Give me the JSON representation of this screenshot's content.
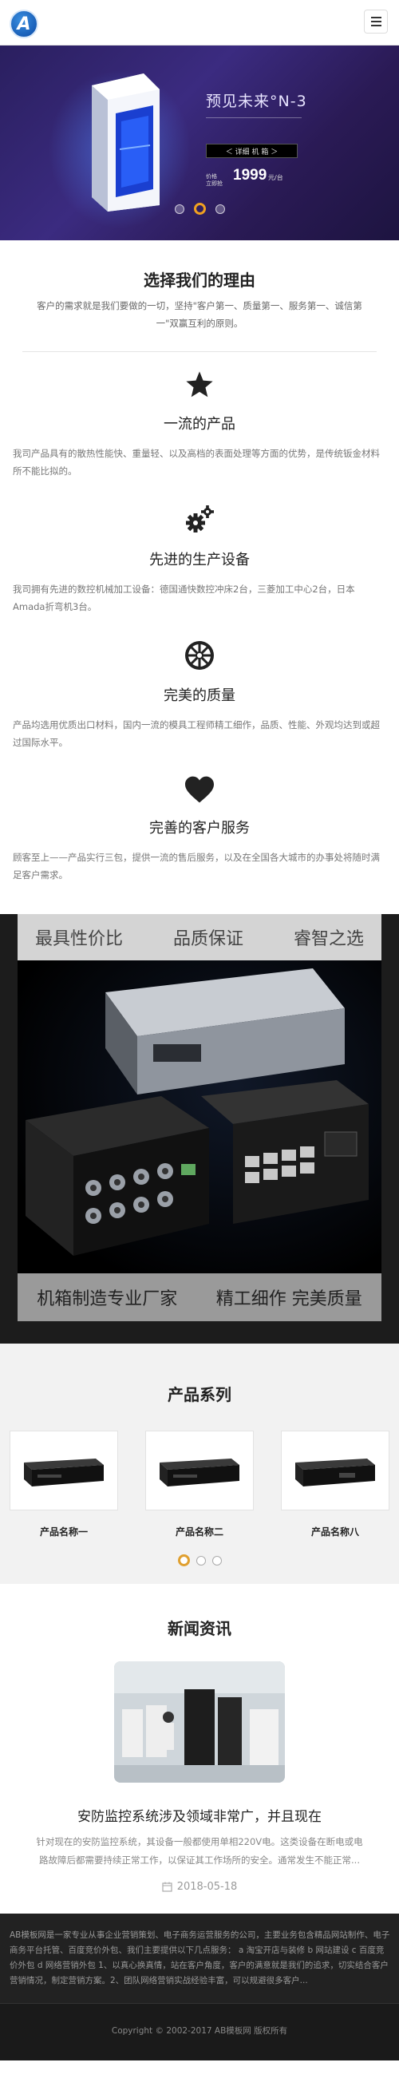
{
  "header": {
    "logo_letter": "A"
  },
  "banner": {
    "title": "预见未来°N-3",
    "button": "＜ 详细 机 箱 ＞",
    "price_label_line1": "价格",
    "price_label_line2": "立即抢",
    "price": "1999",
    "price_unit": "元/台"
  },
  "reasons": {
    "title": "选择我们的理由",
    "subtitle": "客户的需求就是我们要做的一切，坚持\"客户第一、质量第一、服务第一、诚信第一\"双赢互利的原则。",
    "features": [
      {
        "title": "一流的产品",
        "text": "我司产品具有的散热性能快、重量轻、以及高档的表面处理等方面的优势，是传统钣金材料所不能比拟的。"
      },
      {
        "title": "先进的生产设备",
        "text": "我司拥有先进的数控机械加工设备：德国通快数控冲床2台，三菱加工中心2台，日本Amada折弯机3台。"
      },
      {
        "title": "完美的质量",
        "text": "产品均选用优质出口材料，国内一流的模具工程师精工细作，品质、性能、外观均达到或超过国际水平。"
      },
      {
        "title": "完善的客户服务",
        "text": "顾客至上——产品实行三包，提供一流的售后服务，以及在全国各大城市的办事处将随时满足客户需求。"
      }
    ]
  },
  "promo": {
    "top": [
      "最具性价比",
      "品质保证",
      "睿智之选"
    ],
    "bottom": [
      "机箱制造专业厂家",
      "精工细作 完美质量"
    ]
  },
  "products": {
    "title": "产品系列",
    "items": [
      {
        "name": "产品名称一"
      },
      {
        "name": "产品名称二"
      },
      {
        "name": "产品名称八"
      }
    ]
  },
  "news": {
    "title": "新闻资讯",
    "headline": "安防监控系统涉及领域非常广，并且现在",
    "summary": "针对现在的安防监控系统，其设备一般都使用单相220V电。这类设备在断电或电路故障后都需要持续正常工作，以保证其工作场所的安全。通常发生不能正常...",
    "date": "2018-05-18"
  },
  "footer": {
    "text": "AB模板网是一家专业从事企业营销策划、电子商务运营服务的公司，主要业务包含精品网站制作、电子商务平台托管、百度竞价外包、我们主要提供以下几点服务： a 淘宝开店与装修 b 网站建设 c 百度竞价外包 d 网络营销外包 1、以真心换真情，站在客户角度，客户的满意就是我们的追求，切实结合客户营销情况，制定营销方案。2、团队网络营销实战经验丰富，可以规避很多客户...",
    "copyright": "Copyright © 2002-2017 AB模板网 版权所有"
  },
  "colors": {
    "accent": "#f0a020",
    "banner_bg": "#2a1f5f",
    "footer_bg": "#222222"
  }
}
